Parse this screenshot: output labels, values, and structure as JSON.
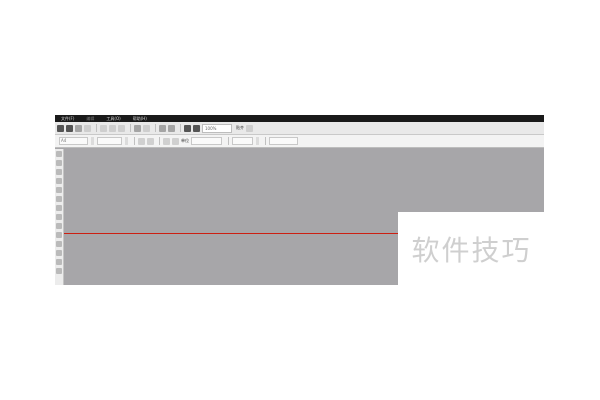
{
  "menubar": {
    "items": [
      {
        "label": "文件(F)"
      },
      {
        "label": "编辑"
      },
      {
        "label": "工具(O)"
      },
      {
        "label": "帮助(H)"
      }
    ]
  },
  "toolbar": {
    "zoom_value": "100%",
    "snap_label": "贴齐"
  },
  "property_bar": {
    "page_size": "A4",
    "unit_label": "单位"
  },
  "watermark": {
    "text": "软件技巧"
  },
  "colors": {
    "canvas_bg": "#a7a6a9",
    "menubar_bg": "#1a1a1a",
    "guide_line": "#cc1f12"
  }
}
